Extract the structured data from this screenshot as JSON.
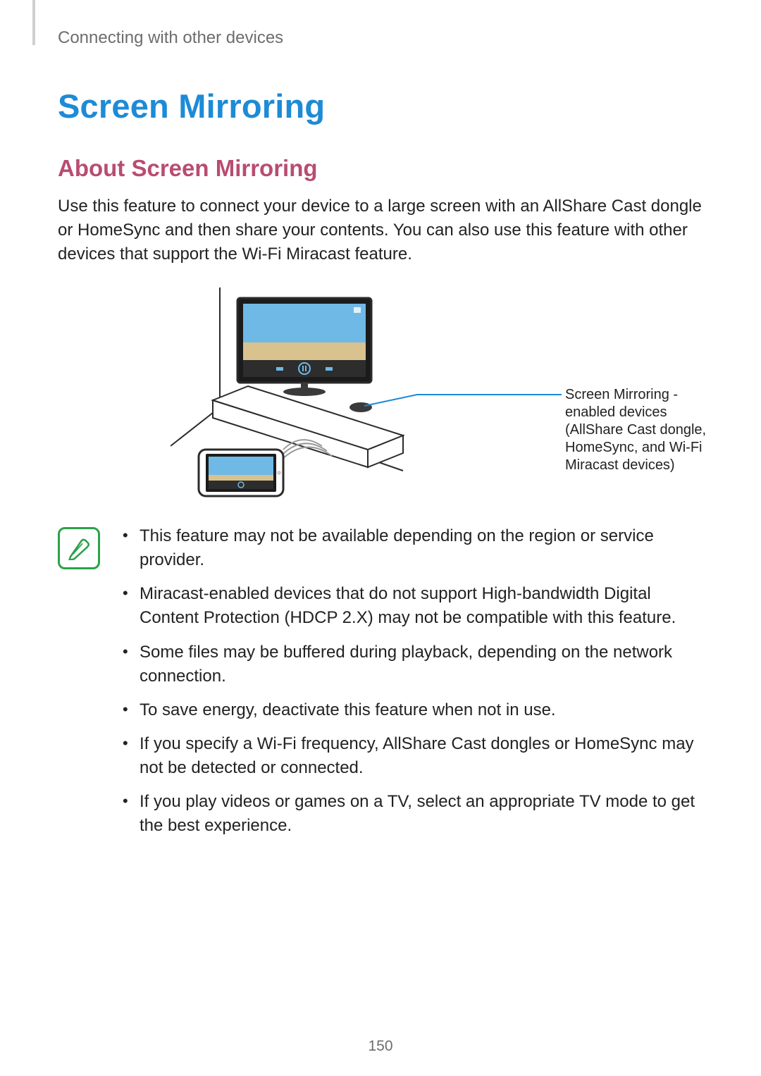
{
  "breadcrumb": "Connecting with other devices",
  "title": "Screen Mirroring",
  "subtitle": "About Screen Mirroring",
  "intro": "Use this feature to connect your device to a large screen with an AllShare Cast dongle or HomeSync and then share your contents. You can also use this feature with other devices that support the Wi-Fi Miracast feature.",
  "callout": "Screen Mirroring -enabled devices (AllShare Cast dongle, HomeSync, and Wi-Fi Miracast devices)",
  "notes": [
    "This feature may not be available depending on the region or service provider.",
    "Miracast-enabled devices that do not support High-bandwidth Digital Content Protection (HDCP 2.X) may not be compatible with this feature.",
    "Some files may be buffered during playback, depending on the network connection.",
    "To save energy, deactivate this feature when not in use.",
    "If you specify a Wi-Fi frequency, AllShare Cast dongles or HomeSync may not be detected or connected.",
    "If you play videos or games on a TV, select an appropriate TV mode to get the best experience."
  ],
  "page_number": "150"
}
